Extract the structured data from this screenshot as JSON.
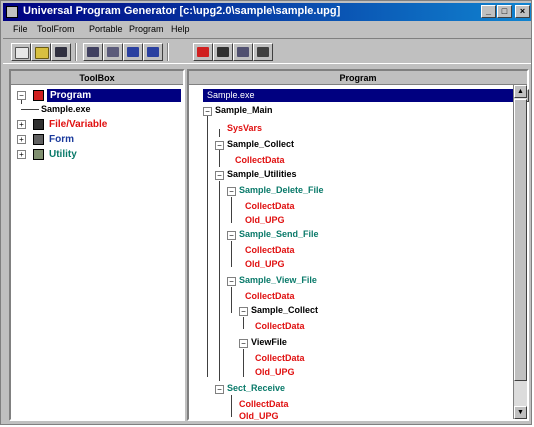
{
  "window": {
    "title": "Universal Program Generator [c:\\upg2.0\\sample\\sample.upg]",
    "minimize_label": "_",
    "maximize_label": "□",
    "close_label": "×"
  },
  "menu": [
    "File",
    "ToolFrom",
    "Portable",
    "Program",
    "Help"
  ],
  "toolbar": {
    "icons": [
      "new-file-icon",
      "open-folder-icon",
      "save-icon",
      "cut-icon",
      "copy-icon",
      "undo-icon",
      "redo-icon",
      "delete-icon",
      "properties-icon",
      "build-icon",
      "run-icon"
    ]
  },
  "toolbox": {
    "header": "ToolBox",
    "items": [
      {
        "label": "Program",
        "color": "#ffffff",
        "selected": true,
        "icon": "program-icon"
      },
      {
        "label": "Sample.exe",
        "color": "#000000",
        "selected": false,
        "icon": ""
      },
      {
        "label": "File/Variable",
        "color": "#e01010",
        "selected": false,
        "icon": "file-variable-icon"
      },
      {
        "label": "Form",
        "color": "#1a3a9c",
        "selected": false,
        "icon": "form-icon"
      },
      {
        "label": "Utility",
        "color": "#0a7a6a",
        "selected": false,
        "icon": "utility-icon"
      }
    ]
  },
  "program": {
    "header": "Program",
    "dropdown_value": "Sample.exe",
    "dropdown_arrow": "▼",
    "scroll_up": "▲",
    "scroll_down": "▼",
    "nodes": [
      {
        "label": "Sample_Main",
        "color": "#1a3a9c"
      },
      {
        "label": "SysVars",
        "color": "#e01010"
      },
      {
        "label": "Sample_Collect",
        "color": "#1a3a9c"
      },
      {
        "label": "CollectData",
        "color": "#e01010"
      },
      {
        "label": "Sample_Utilities",
        "color": "#1a3a9c"
      },
      {
        "label": "Sample_Delete_File",
        "color": "#0a7a6a"
      },
      {
        "label": "CollectData",
        "color": "#e01010"
      },
      {
        "label": "Old_UPG",
        "color": "#e01010"
      },
      {
        "label": "Sample_Send_File",
        "color": "#0a7a6a"
      },
      {
        "label": "CollectData",
        "color": "#e01010"
      },
      {
        "label": "Old_UPG",
        "color": "#e01010"
      },
      {
        "label": "Sample_View_File",
        "color": "#0a7a6a"
      },
      {
        "label": "CollectData",
        "color": "#e01010"
      },
      {
        "label": "Sample_Collect",
        "color": "#1a3a9c"
      },
      {
        "label": "CollectData",
        "color": "#e01010"
      },
      {
        "label": "ViewFile",
        "color": "#1a3a9c"
      },
      {
        "label": "CollectData",
        "color": "#e01010"
      },
      {
        "label": "Old_UPG",
        "color": "#e01010"
      },
      {
        "label": "Sect_Receive",
        "color": "#0a7a6a"
      },
      {
        "label": "CollectData",
        "color": "#e01010"
      },
      {
        "label": "Old_UPG",
        "color": "#e01010"
      }
    ]
  }
}
